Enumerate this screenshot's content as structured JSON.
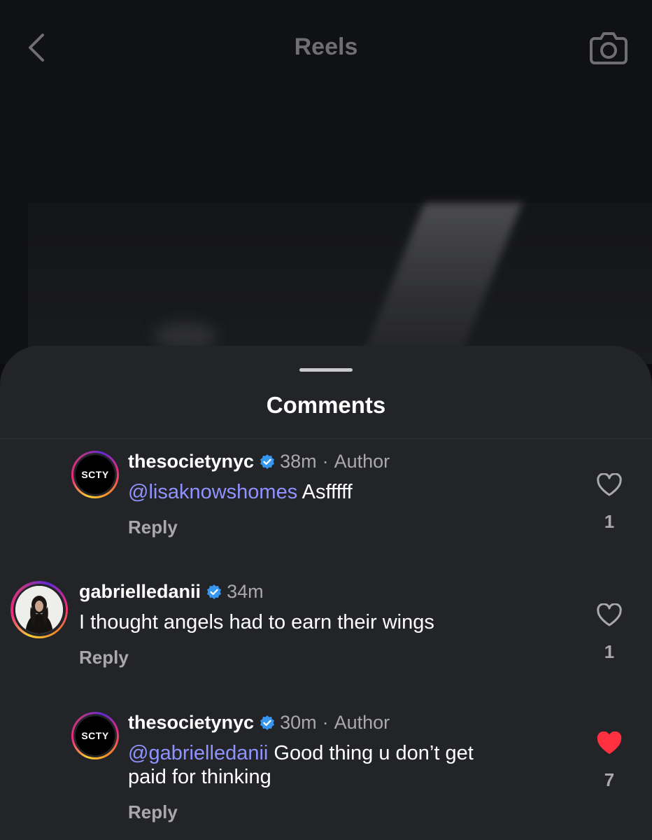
{
  "header": {
    "title": "Reels",
    "back_icon": "chevron-left-icon",
    "camera_icon": "camera-icon"
  },
  "sheet": {
    "title": "Comments"
  },
  "comments": [
    {
      "username": "thesocietynyc",
      "avatar_text": "SCTY",
      "verified": true,
      "time": "38m",
      "separator": "·",
      "author_label": "Author",
      "mention": "@lisaknowshomes",
      "text": " Asfffff",
      "reply_label": "Reply",
      "likes": "1",
      "liked": false
    },
    {
      "username": "gabrielledanii",
      "verified": true,
      "time": "34m",
      "text": "I thought angels had to earn their wings",
      "reply_label": "Reply",
      "likes": "1",
      "liked": false
    },
    {
      "username": "thesocietynyc",
      "avatar_text": "SCTY",
      "verified": true,
      "time": "30m",
      "separator": "·",
      "author_label": "Author",
      "mention": "@gabrielledanii",
      "text": " Good thing u don’t get",
      "text_line2": "paid for thinking",
      "reply_label": "Reply",
      "likes": "7",
      "liked": true
    }
  ],
  "colors": {
    "sheet_bg": "#232428",
    "mention": "#8f93ff",
    "verified": "#3797f0",
    "liked_heart": "#ff3040",
    "muted_text": "#a8a8ad"
  }
}
